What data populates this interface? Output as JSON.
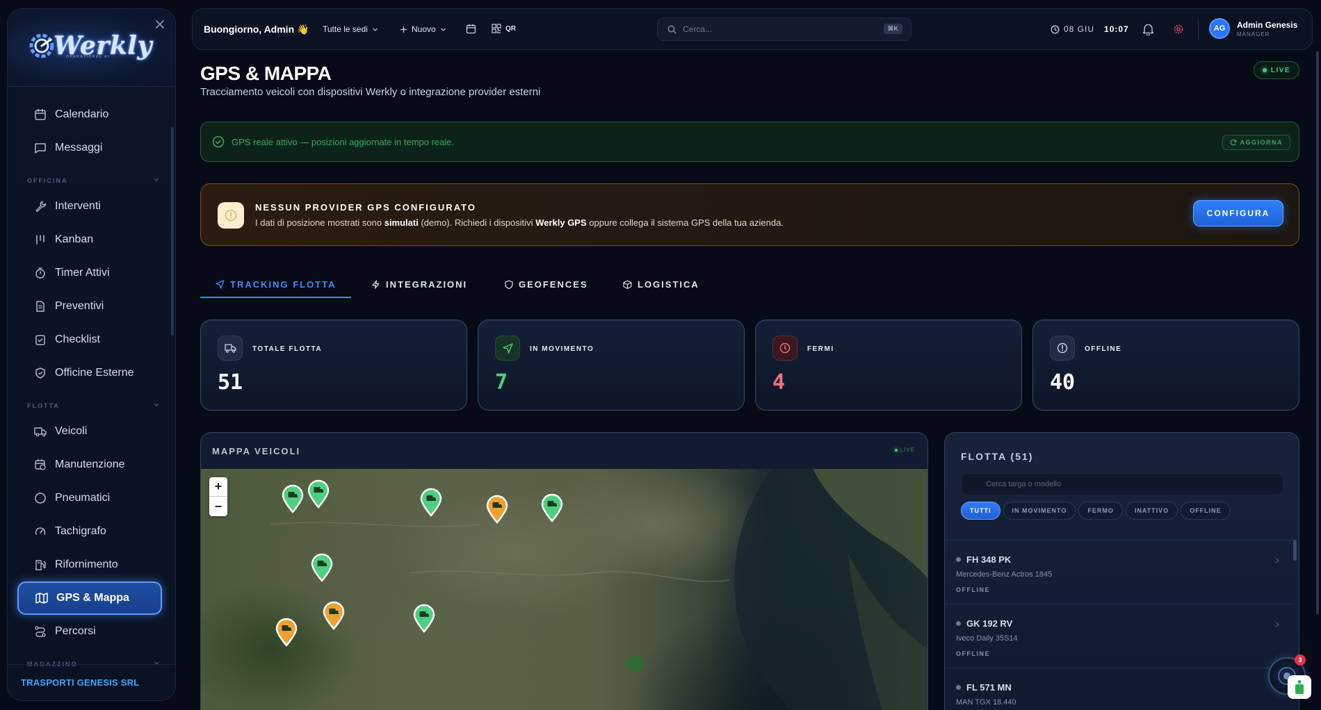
{
  "sidebar": {
    "logo_text": "Werkly",
    "logo_tagline": "OPERATIONAL AI",
    "items": [
      {
        "label": "Calendario"
      },
      {
        "label": "Messaggi"
      },
      {
        "label": "Interventi"
      },
      {
        "label": "Kanban"
      },
      {
        "label": "Timer Attivi"
      },
      {
        "label": "Preventivi"
      },
      {
        "label": "Checklist"
      },
      {
        "label": "Officine Esterne"
      },
      {
        "label": "Veicoli"
      },
      {
        "label": "Manutenzione"
      },
      {
        "label": "Pneumatici"
      },
      {
        "label": "Tachigrafo"
      },
      {
        "label": "Rifornimento"
      },
      {
        "label": "GPS & Mappa"
      },
      {
        "label": "Percorsi"
      }
    ],
    "sections": {
      "officina": "OFFICINA",
      "flotta": "FLOTTA",
      "magazzino": "MAGAZZINO"
    },
    "active_item": "GPS & Mappa",
    "company": "TRASPORTI GENESIS SRL"
  },
  "topbar": {
    "greeting": "Buongiorno, Admin 👋",
    "location_select": "Tutte le sedi",
    "new_label": "Nuovo",
    "qr_label": "QR",
    "search_placeholder": "Cerca...",
    "search_shortcut": "⌘K",
    "date": "08 GIU",
    "time": "10:07",
    "user_initials": "AG",
    "user_name": "Admin Genesis",
    "user_role": "MANAGER"
  },
  "page": {
    "title": "GPS & MAPPA",
    "subtitle": "Tracciamento veicoli con dispositivi Werkly o integrazione provider esterni",
    "live_label": "LIVE"
  },
  "gps_banner": {
    "text": "GPS reale attivo — posizioni aggiornate in tempo reale.",
    "refresh_label": "AGGIORNA"
  },
  "warning": {
    "title": "NESSUN PROVIDER GPS CONFIGURATO",
    "text_1": "I dati di posizione mostrati sono ",
    "text_bold_1": "simulati",
    "text_2": " (demo). Richiedi i dispositivi ",
    "text_bold_2": "Werkly GPS",
    "text_3": " oppure collega il sistema GPS della tua azienda.",
    "button_label": "CONFIGURA"
  },
  "tabs": [
    {
      "label": "TRACKING FLOTTA"
    },
    {
      "label": "INTEGRAZIONI"
    },
    {
      "label": "GEOFENCES"
    },
    {
      "label": "LOGISTICA"
    }
  ],
  "stats": [
    {
      "label": "TOTALE FLOTTA",
      "value": "51",
      "color": "#ffffff"
    },
    {
      "label": "IN MOVIMENTO",
      "value": "7",
      "color": "#4ccf7f"
    },
    {
      "label": "FERMI",
      "value": "4",
      "color": "#f0707d"
    },
    {
      "label": "OFFLINE",
      "value": "40",
      "color": "#ffffff"
    }
  ],
  "map": {
    "title": "MAPPA VEICOLI",
    "live_label": "LIVE",
    "zoom_in": "+",
    "zoom_out": "−",
    "pins": [
      {
        "status": "moving"
      },
      {
        "status": "moving"
      },
      {
        "status": "moving"
      },
      {
        "status": "stopped"
      },
      {
        "status": "moving"
      },
      {
        "status": "moving"
      },
      {
        "status": "stopped"
      },
      {
        "status": "moving"
      },
      {
        "status": "stopped"
      }
    ]
  },
  "fleet": {
    "title": "FLOTTA (51)",
    "search_placeholder": "Cerca targa o modello",
    "filters": [
      {
        "label": "TUTTI"
      },
      {
        "label": "IN MOVIMENTO"
      },
      {
        "label": "FERMO"
      },
      {
        "label": "INATTIVO"
      },
      {
        "label": "OFFLINE"
      }
    ],
    "rows": [
      {
        "plate": "FH 348 PK",
        "model": "Mercedes-Benz Actros 1845",
        "status": "OFFLINE"
      },
      {
        "plate": "GK 192 RV",
        "model": "Iveco Daily 35S14",
        "status": "OFFLINE"
      },
      {
        "plate": "FL 571 MN",
        "model": "MAN TGX 18.440",
        "status": ""
      }
    ]
  },
  "notifications": {
    "badge": "3"
  },
  "colors": {
    "accent": "#3d8dff",
    "moving": "#4ccf7f",
    "stopped": "#f0a030",
    "danger": "#f0707d"
  }
}
